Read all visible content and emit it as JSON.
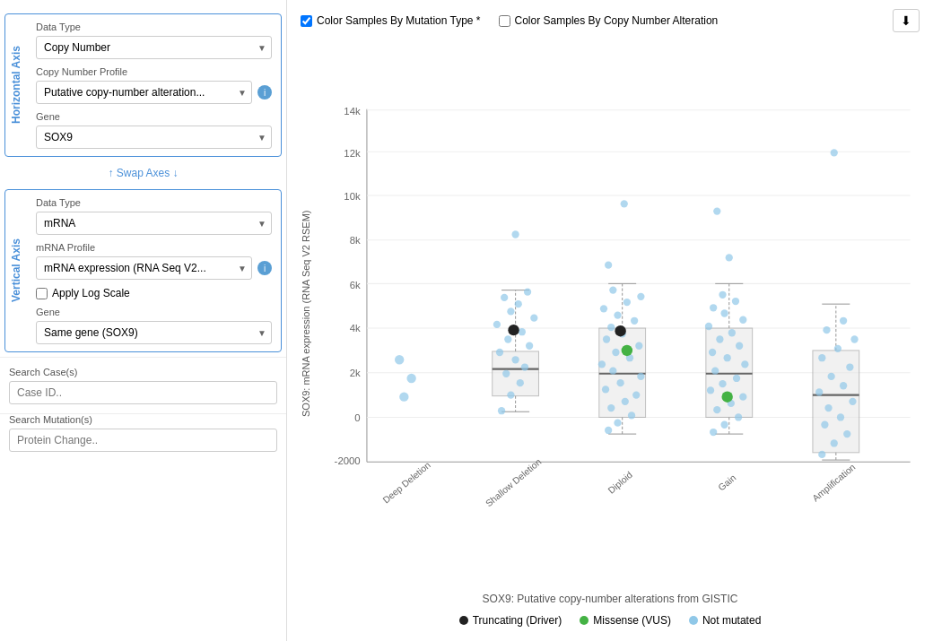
{
  "left_panel": {
    "horizontal_axis": {
      "label": "Horizontal Axis",
      "data_type_label": "Data Type",
      "data_type_value": "Copy Number",
      "copy_number_profile_label": "Copy Number Profile",
      "copy_number_profile_value": "Putative copy-number alteration...",
      "gene_label": "Gene",
      "gene_value": "SOX9"
    },
    "swap_axes": "↑ Swap Axes ↓",
    "vertical_axis": {
      "label": "Vertical Axis",
      "data_type_label": "Data Type",
      "data_type_value": "mRNA",
      "mrna_profile_label": "mRNA Profile",
      "mrna_profile_value": "mRNA expression (RNA Seq V2...",
      "apply_log_scale": "Apply Log Scale",
      "gene_label": "Gene",
      "gene_value": "Same gene (SOX9)"
    }
  },
  "search_cases": {
    "label": "Search Case(s)",
    "placeholder": "Case ID.."
  },
  "search_mutations": {
    "label": "Search Mutation(s)",
    "placeholder": "Protein Change.."
  },
  "chart": {
    "color_by_mutation_label": "Color Samples By Mutation Type *",
    "color_by_copy_number_label": "Color Samples By Copy Number Alteration",
    "y_axis_label": "SOX9: mRNA expression (RNA Seq V2 RSEM)",
    "footer": "SOX9: Putative copy-number alterations from GISTIC",
    "x_categories": [
      "Deep Deletion",
      "Shallow Deletion",
      "Diploid",
      "Gain",
      "Amplification"
    ],
    "y_ticks": [
      "-2000",
      "0",
      "2k",
      "4k",
      "6k",
      "8k",
      "10k",
      "12k",
      "14k"
    ]
  },
  "legend": {
    "items": [
      {
        "label": "Truncating (Driver)",
        "color": "#222"
      },
      {
        "label": "Missense (VUS)",
        "color": "#44b244"
      },
      {
        "label": "Not mutated",
        "color": "#90c8e8"
      }
    ]
  }
}
